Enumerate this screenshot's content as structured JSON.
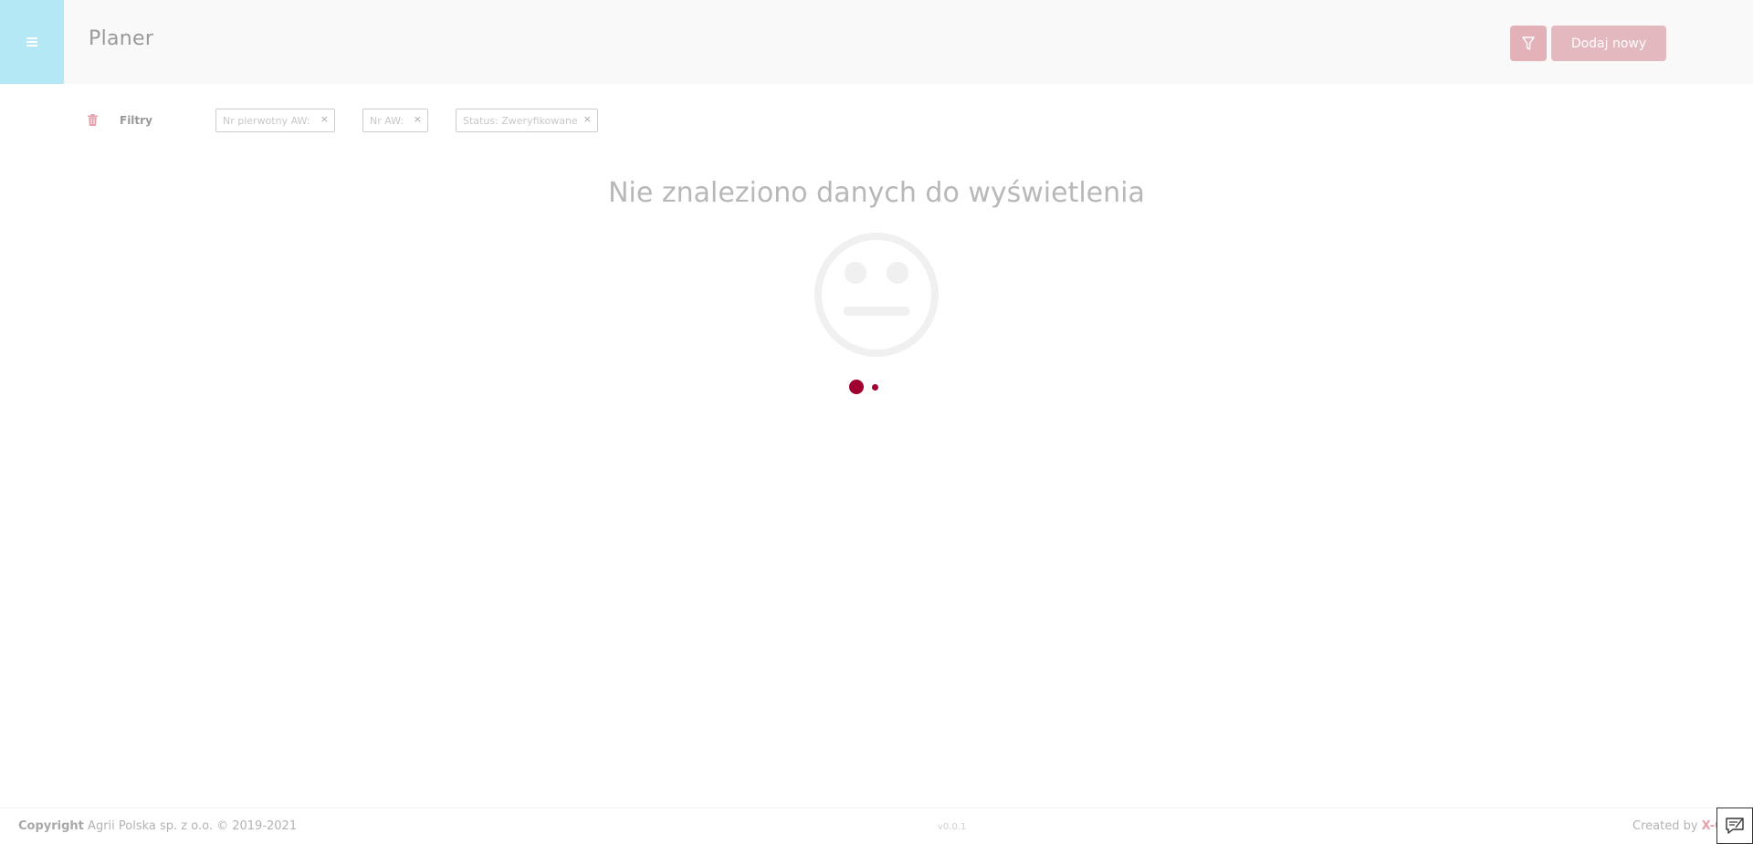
{
  "header": {
    "title": "Planer",
    "add_button_label": "Dodaj nowy"
  },
  "filters": {
    "label": "Filtry",
    "chips": [
      {
        "label": "Nr pierwotny AW:",
        "remove": "×"
      },
      {
        "label": "Nr AW:",
        "remove": "×"
      },
      {
        "label": "Status: Zweryfikowane",
        "remove": "×"
      }
    ]
  },
  "main": {
    "empty_message": "Nie znaleziono danych do wyświetlenia"
  },
  "footer": {
    "copyright_bold": "Copyright",
    "copyright_text": "Agrii Polska sp. z o.o. © 2019-2021",
    "version": "v0.0.1",
    "created_by": "Created by",
    "brand": "X-CI"
  },
  "icons": {
    "menu": "hamburger-icon",
    "filter": "funnel-icon",
    "trash": "trash-icon",
    "empty": "neutral-face-icon",
    "feedback": "feedback-icon"
  },
  "colors": {
    "accent": "#a00030",
    "menu_bg": "#b4e8f5",
    "button_bg": "#e3b8be"
  }
}
